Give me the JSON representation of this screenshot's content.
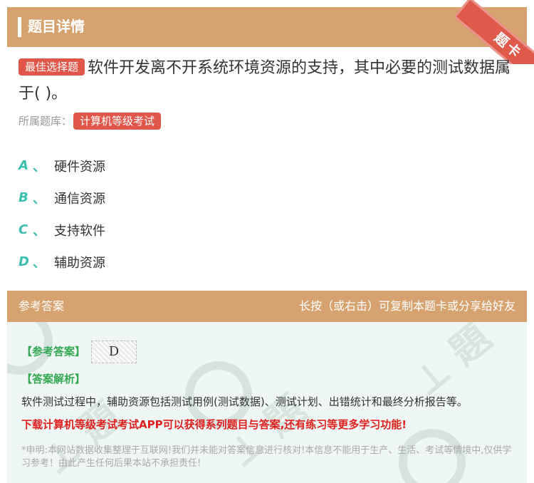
{
  "header": {
    "title": "题目详情",
    "ribbon": "题卡"
  },
  "question": {
    "type_badge": "最佳选择题",
    "text": "软件开发离不开系统环境资源的支持，其中必要的测试数据属于( )。",
    "source_label": "所属题库：",
    "source_badge": "计算机等级考试"
  },
  "options": [
    {
      "letter": "A",
      "text": "硬件资源"
    },
    {
      "letter": "B",
      "text": "通信资源"
    },
    {
      "letter": "C",
      "text": "支持软件"
    },
    {
      "letter": "D",
      "text": "辅助资源"
    }
  ],
  "option_separator": "、",
  "answer_panel": {
    "left_label": "参考答案",
    "right_hint": "长按（或右击）可复制本题卡或分享给好友",
    "answer_label": "【参考答案】",
    "answer_value": "D",
    "analysis_label": "【答案解析】",
    "analysis_text": "软件测试过程中，辅助资源包括测试用例(测试数据)、测试计划、出错统计和最终分析报告等。",
    "promo_text": "下载计算机等级考试考试APP可以获得系列题目与答案,还有练习等更多学习功能!",
    "disclaimer": "*申明:本网站数据收集整理于互联网!我们并未能对答案信息进行核对!本信息不能用于生产、生活、考试等情境中,仅供学习参考！由此产生任何后果本站不承担责任!"
  },
  "colors": {
    "accent": "#d6a370",
    "red": "#e0574a",
    "teal": "#3dbfb0",
    "green": "#34a853",
    "panel_bg": "#eef7f3"
  }
}
